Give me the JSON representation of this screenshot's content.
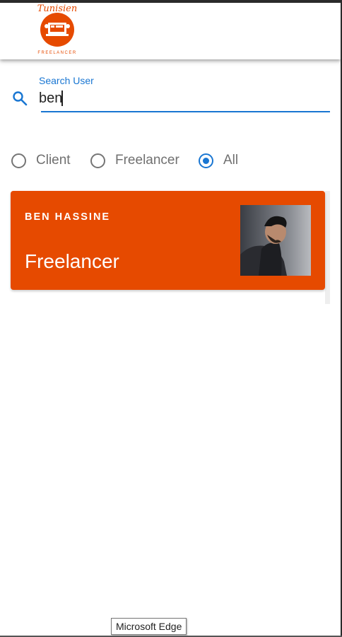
{
  "header": {
    "logo_text_top": "Tunisien",
    "logo_text_bottom": "FREELANCER"
  },
  "search": {
    "label": "Search User",
    "value": "ben"
  },
  "filter": {
    "options": [
      {
        "label": "Client",
        "checked": false
      },
      {
        "label": "Freelancer",
        "checked": false
      },
      {
        "label": "All",
        "checked": true
      }
    ]
  },
  "results": [
    {
      "name": "BEN HASSINE",
      "role": "Freelancer"
    }
  ],
  "tooltip": "Microsoft Edge",
  "colors": {
    "accent": "#1976d2",
    "brand": "#e64a00"
  }
}
